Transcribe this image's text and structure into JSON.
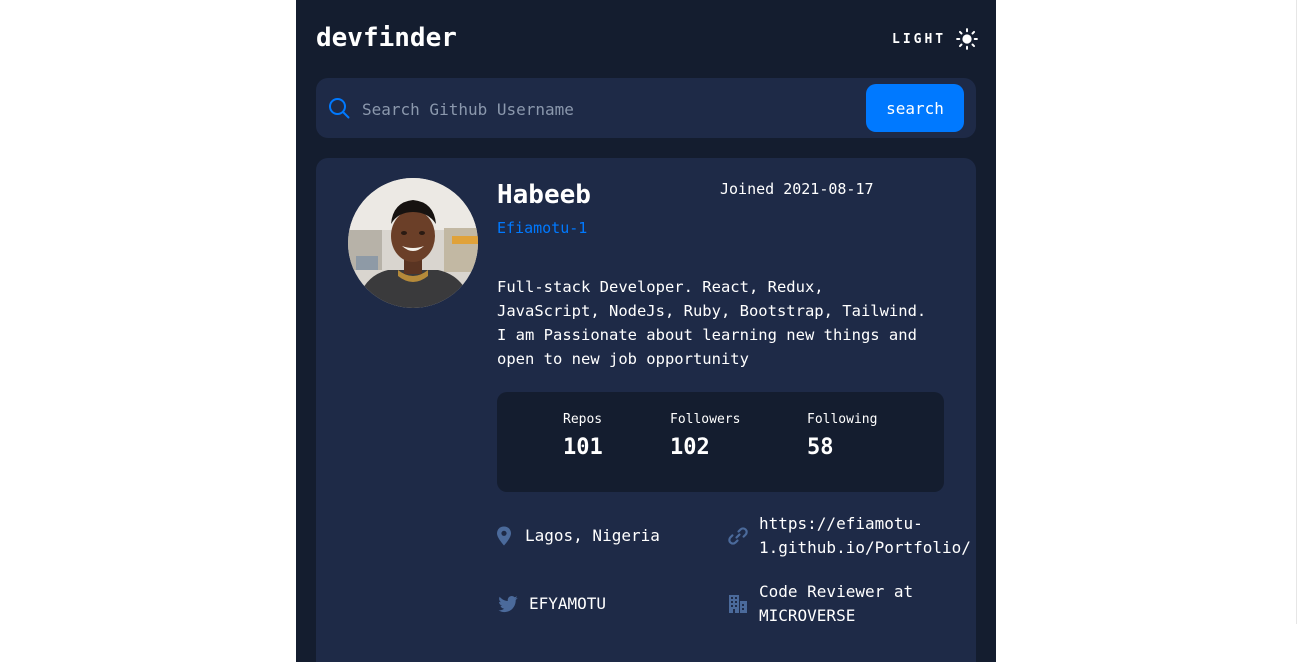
{
  "header": {
    "logo": "devfinder",
    "theme_label": "LIGHT",
    "theme_icon": "sun-icon"
  },
  "search": {
    "placeholder": "Search Github Username",
    "value": "",
    "button_label": "search",
    "icon": "search-icon"
  },
  "profile": {
    "name": "Habeeb",
    "login": "Efiamotu-1",
    "joined": "Joined 2021-08-17",
    "bio_lines": [
      "Full-stack Developer. React, Redux,",
      "JavaScript, NodeJs, Ruby, Bootstrap, Tailwind.",
      "I am Passionate about learning new things and",
      "open to new job opportunity"
    ],
    "stats": [
      {
        "label": "Repos",
        "value": "101"
      },
      {
        "label": "Followers",
        "value": "102"
      },
      {
        "label": "Following",
        "value": "58"
      }
    ],
    "links": {
      "location": {
        "icon": "location-pin-icon",
        "text": "Lagos, Nigeria"
      },
      "website": {
        "icon": "link-icon",
        "lines": [
          "https://efiamotu-",
          "1.github.io/Portfolio/"
        ]
      },
      "twitter": {
        "icon": "twitter-icon",
        "text": "EFYAMOTU"
      },
      "company": {
        "icon": "office-building-icon",
        "lines": [
          "Code Reviewer at",
          "MICROVERSE"
        ]
      }
    }
  },
  "colors": {
    "background": "#141d2f",
    "card": "#1e2a47",
    "accent": "#0079ff",
    "icon_muted": "#4b6a9b",
    "text": "#ffffff"
  }
}
